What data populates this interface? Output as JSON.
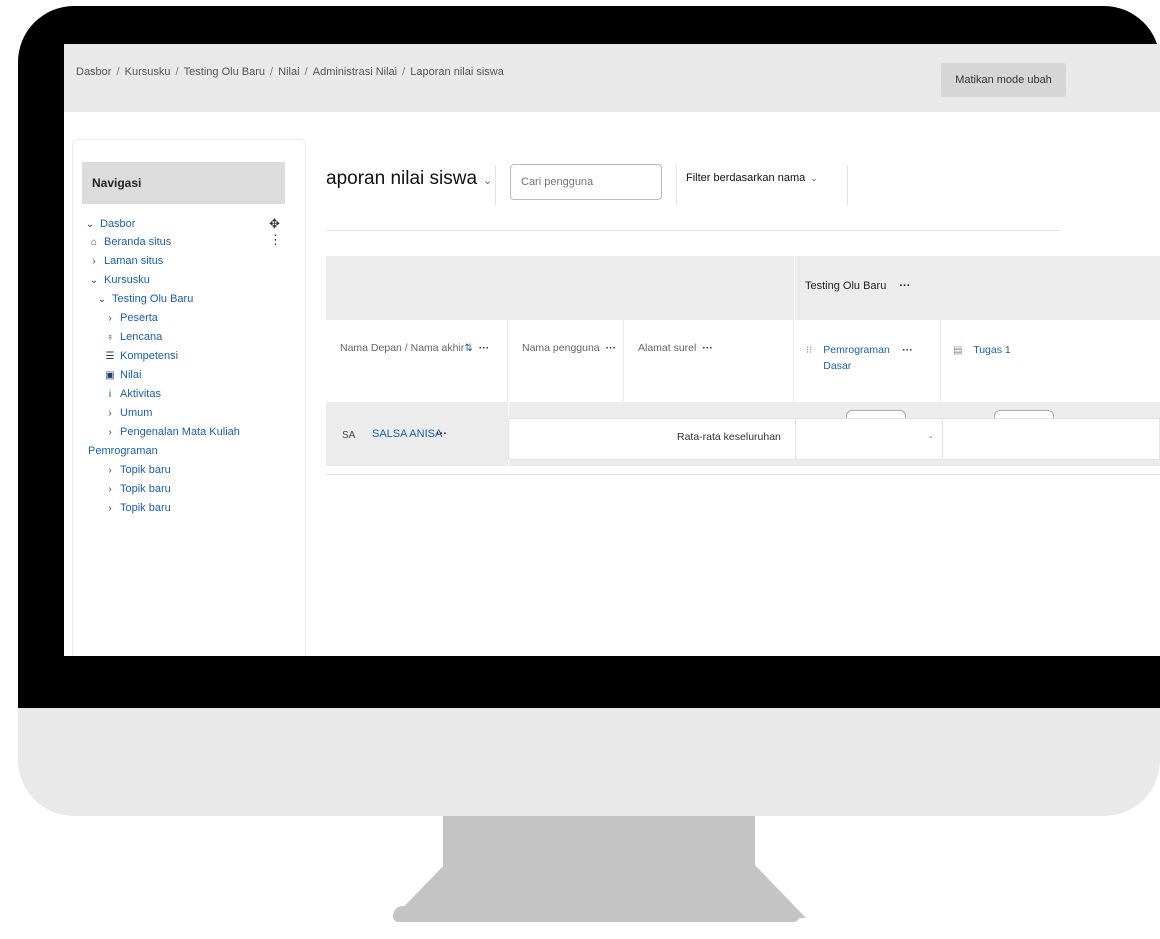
{
  "breadcrumb": [
    "Dasbor",
    "Kursusku",
    "Testing Olu Baru",
    "Nilai",
    "Administrasi Nilai",
    "Laporan nilai siswa"
  ],
  "header": {
    "edit_mode_label": "Matikan mode ubah"
  },
  "navigation": {
    "title": "Navigasi",
    "items": [
      {
        "label": "Dasbor",
        "icon": "chevron-down-icon"
      },
      {
        "label": "Beranda situs",
        "icon": "home-icon"
      },
      {
        "label": "Laman situs",
        "icon": "chevron-right-icon"
      },
      {
        "label": "Kursusku",
        "icon": "chevron-down-icon"
      },
      {
        "label": "Testing Olu Baru",
        "icon": "chevron-down-icon"
      },
      {
        "label": "Peserta",
        "icon": "chevron-right-icon"
      },
      {
        "label": "Lencana",
        "icon": "badge-icon"
      },
      {
        "label": "Kompetensi",
        "icon": "competency-icon"
      },
      {
        "label": "Nilai",
        "icon": "grades-icon"
      },
      {
        "label": "Aktivitas",
        "icon": "info-icon"
      },
      {
        "label": "Umum",
        "icon": "chevron-right-icon"
      },
      {
        "label": "Pengenalan Mata Kuliah",
        "icon": "chevron-right-icon"
      },
      {
        "label": "Pemrograman",
        "icon": ""
      },
      {
        "label": "Topik baru",
        "icon": "chevron-right-icon"
      },
      {
        "label": "Topik baru",
        "icon": "chevron-right-icon"
      },
      {
        "label": "Topik baru",
        "icon": "chevron-right-icon"
      }
    ]
  },
  "main": {
    "title": "aporan nilai siswa",
    "search_placeholder": "Cari pengguna",
    "filter_label": "Filter berdasarkan nama"
  },
  "table": {
    "course_name": "Testing Olu Baru",
    "columns": {
      "name": "Nama Depan / Nama akhir",
      "username": "Nama pengguna",
      "email": "Alamat surel",
      "assign1": "Pemrograman Dasar",
      "assign2": "Tugas 1"
    },
    "student": {
      "initials": "SA",
      "name": "SALSA ANISA"
    },
    "overall_label": "Rata-rata keseluruhan",
    "overall_value": "-"
  },
  "colors": {
    "link": "#1b5fb0",
    "header_bg": "#e9e9e9",
    "table_bg": "#ececec"
  }
}
